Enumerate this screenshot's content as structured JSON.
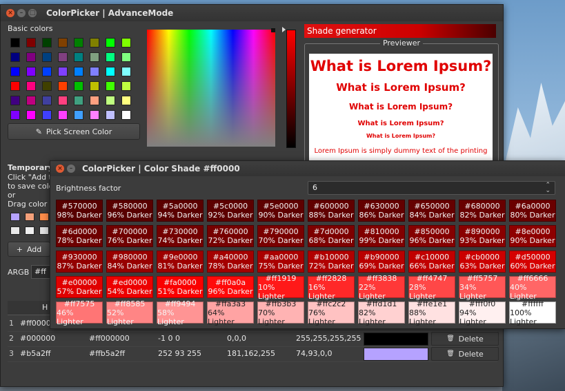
{
  "main_window": {
    "title": "ColorPicker | AdvanceMode",
    "basic_colors_label": "Basic colors",
    "basic_colors": [
      "#000000",
      "#800000",
      "#004000",
      "#804000",
      "#008000",
      "#808000",
      "#00ff00",
      "#80ff00",
      "#000080",
      "#800080",
      "#004080",
      "#804080",
      "#008080",
      "#80a080",
      "#00ff80",
      "#80ff80",
      "#0000ff",
      "#8000ff",
      "#0040ff",
      "#8040ff",
      "#0080ff",
      "#8080ff",
      "#00ffff",
      "#80ffff",
      "#ff0000",
      "#ff0080",
      "#404000",
      "#ff4000",
      "#00c000",
      "#c0c000",
      "#40ff00",
      "#c0ff40",
      "#400080",
      "#c00080",
      "#4040a0",
      "#ff4080",
      "#40a080",
      "#ffa080",
      "#c0ff80",
      "#ffff80",
      "#8000ff",
      "#ff00ff",
      "#4040ff",
      "#ff40ff",
      "#40a0ff",
      "#ff80ff",
      "#c0c0ff",
      "#ffffff"
    ],
    "pick_screen_label": "Pick Screen Color",
    "shade_generator_label": "Shade generator",
    "previewer_label": "Previewer",
    "preview_lines": [
      "What is Lorem Ipsum?",
      "What is Lorem Ipsum?",
      "What is Lorem Ipsum?",
      "What is Lorem Ipsum?",
      "What is Lorem Ipsum?",
      "Lorem Ipsum is simply dummy text of the printing"
    ],
    "temporary_label": "Temporary",
    "temp_help": [
      "Click \"Add to",
      "to save color",
      "or",
      "Drag color to"
    ],
    "temp_swatches": [
      "#b5a2ff",
      "#f4a07a",
      "#ff8d4a",
      "#e8e8e8",
      "#f0f0f0",
      "#e0e0e0"
    ],
    "add_label": "Add",
    "argb_label": "ARGB",
    "argb_value": "#ff",
    "table_header_first": "H",
    "table_rows": [
      {
        "num": "1",
        "hex": "#ff0000",
        "argb": "",
        "hsv": "",
        "cmyk": "",
        "rgba": "",
        "swatch": "",
        "delete": ""
      },
      {
        "num": "2",
        "hex": "#000000",
        "argb": "#ff000000",
        "hsv": "-1 0 0",
        "cmyk": "0,0,0",
        "rgba": "255,255,255,255",
        "swatch": "#000000",
        "delete": "Delete"
      },
      {
        "num": "3",
        "hex": "#b5a2ff",
        "argb": "#ffb5a2ff",
        "hsv": "252 93 255",
        "cmyk": "181,162,255",
        "rgba": "74,93,0,0",
        "swatch": "#b5a2ff",
        "delete": "Delete"
      }
    ]
  },
  "shade_dialog": {
    "title": "ColorPicker | Color Shade #ff0000",
    "brightness_label": "Brightness factor",
    "brightness_value": "6",
    "shades": [
      {
        "hex": "#570000",
        "label": "98% Darker"
      },
      {
        "hex": "#580000",
        "label": "96% Darker"
      },
      {
        "hex": "#5a0000",
        "label": "94% Darker"
      },
      {
        "hex": "#5c0000",
        "label": "92% Darker"
      },
      {
        "hex": "#5e0000",
        "label": "90% Darker"
      },
      {
        "hex": "#600000",
        "label": "88% Darker"
      },
      {
        "hex": "#630000",
        "label": "86% Darker"
      },
      {
        "hex": "#650000",
        "label": "84% Darker"
      },
      {
        "hex": "#680000",
        "label": "82% Darker"
      },
      {
        "hex": "#6a0000",
        "label": "80% Darker"
      },
      {
        "hex": "#6d0000",
        "label": "78% Darker"
      },
      {
        "hex": "#700000",
        "label": "76% Darker"
      },
      {
        "hex": "#730000",
        "label": "74% Darker"
      },
      {
        "hex": "#760000",
        "label": "72% Darker"
      },
      {
        "hex": "#790000",
        "label": "70% Darker"
      },
      {
        "hex": "#7d0000",
        "label": "68% Darker"
      },
      {
        "hex": "#810000",
        "label": "99% Darker"
      },
      {
        "hex": "#850000",
        "label": "96% Darker"
      },
      {
        "hex": "#890000",
        "label": "93% Darker"
      },
      {
        "hex": "#8e0000",
        "label": "90% Darker"
      },
      {
        "hex": "#930000",
        "label": "87% Darker"
      },
      {
        "hex": "#980000",
        "label": "84% Darker"
      },
      {
        "hex": "#9e0000",
        "label": "81% Darker"
      },
      {
        "hex": "#a40000",
        "label": "78% Darker"
      },
      {
        "hex": "#aa0000",
        "label": "75% Darker"
      },
      {
        "hex": "#b10000",
        "label": "72% Darker"
      },
      {
        "hex": "#b90000",
        "label": "69% Darker"
      },
      {
        "hex": "#c10000",
        "label": "66% Darker"
      },
      {
        "hex": "#cb0000",
        "label": "63% Darker"
      },
      {
        "hex": "#d50000",
        "label": "60% Darker"
      },
      {
        "hex": "#e00000",
        "label": "57% Darker"
      },
      {
        "hex": "#ed0000",
        "label": "54% Darker"
      },
      {
        "hex": "#fa0000",
        "label": "51% Darker"
      },
      {
        "hex": "#ff0a0a",
        "label": "96% Darker"
      },
      {
        "hex": "#ff1919",
        "label": "10% Lighter"
      },
      {
        "hex": "#ff2828",
        "label": "16% Lighter"
      },
      {
        "hex": "#ff3838",
        "label": "22% Lighter"
      },
      {
        "hex": "#ff4747",
        "label": "28% Lighter"
      },
      {
        "hex": "#ff5757",
        "label": "34% Lighter"
      },
      {
        "hex": "#ff6666",
        "label": "40% Lighter"
      },
      {
        "hex": "#ff7575",
        "label": "46% Lighter"
      },
      {
        "hex": "#ff8585",
        "label": "52% Lighter"
      },
      {
        "hex": "#ff9494",
        "label": "58% Lighter"
      },
      {
        "hex": "#ffa3a3",
        "label": "64% Lighter"
      },
      {
        "hex": "#ffb3b3",
        "label": "70% Lighter"
      },
      {
        "hex": "#ffc2c2",
        "label": "76% Lighter"
      },
      {
        "hex": "#ffd1d1",
        "label": "82% Lighter"
      },
      {
        "hex": "#ffe1e1",
        "label": "88% Lighter"
      },
      {
        "hex": "#fff0f0",
        "label": "94% Lighter"
      },
      {
        "hex": "#ffffff",
        "label": "100% Lighter"
      }
    ]
  },
  "colors": {
    "accent_red": "#ff0000",
    "window_bg": "#3c3c3c",
    "close_button": "#e05a33"
  }
}
